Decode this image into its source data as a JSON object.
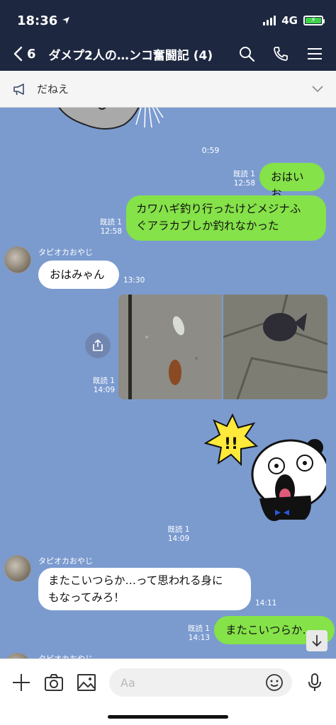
{
  "status": {
    "time": "18:36",
    "network": "4G"
  },
  "header": {
    "back_count": "6",
    "title": "ダメプ2人の…ンコ奮闘記 (4)"
  },
  "announcement": {
    "text": "だねえ"
  },
  "messages": {
    "t1": "0:59",
    "m1": {
      "text": "おはいお",
      "read": "既読 1",
      "time": "12:58"
    },
    "m2": {
      "line1": "カワハギ釣り行ったけどメジナふ",
      "line2": "ぐアラカブしか釣れなかった",
      "read": "既読 1",
      "time": "12:58"
    },
    "m3": {
      "name": "タピオカおやじ",
      "text": "おはみゃん",
      "time": "13:30"
    },
    "m4": {
      "read": "既読 1",
      "time": "14:09"
    },
    "m5": {
      "read": "既読 1",
      "time": "14:09"
    },
    "m6": {
      "name": "タピオカおやじ",
      "line1": "またこいつらか…って思われる身に",
      "line2": "もなってみろ！",
      "time": "14:11"
    },
    "m7": {
      "text": "またこいつらか…",
      "read": "既読 1",
      "time": "14:13"
    },
    "m8": {
      "name": "タピオカおやじ"
    }
  },
  "input": {
    "placeholder": "Aa"
  },
  "colors": {
    "header_bg": "#1d2740",
    "chat_bg": "#7b9bcf",
    "green_bubble": "#85e249"
  }
}
